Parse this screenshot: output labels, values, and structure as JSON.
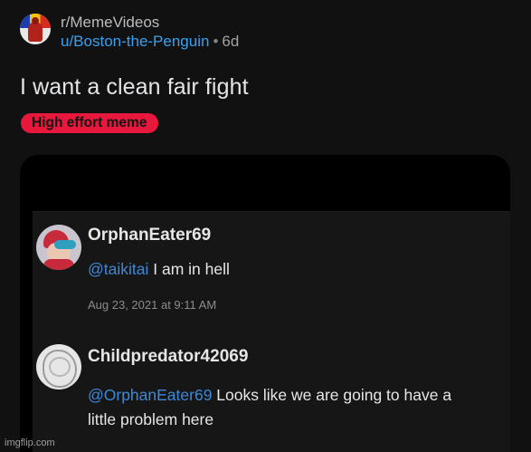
{
  "post": {
    "subreddit": "r/MemeVideos",
    "author": "u/Boston-the-Penguin",
    "separator": "•",
    "age": "6d",
    "title": "I want a clean fair fight",
    "flair": "High effort meme"
  },
  "comments": [
    {
      "username": "OrphanEater69",
      "mention": "@taikitai",
      "text": " I am in hell",
      "timestamp": "Aug 23, 2021 at 9:11 AM"
    },
    {
      "username": "Childpredator42069",
      "mention": "@OrphanEater69",
      "text_line1": " Looks like we are going to have a",
      "text_line2": "little problem here"
    }
  ],
  "watermark": "imgflip.com",
  "colors": {
    "background": "#111112",
    "username_link": "#3aa0ee",
    "flair_bg": "#e8173c",
    "mention": "#3f88d8"
  }
}
